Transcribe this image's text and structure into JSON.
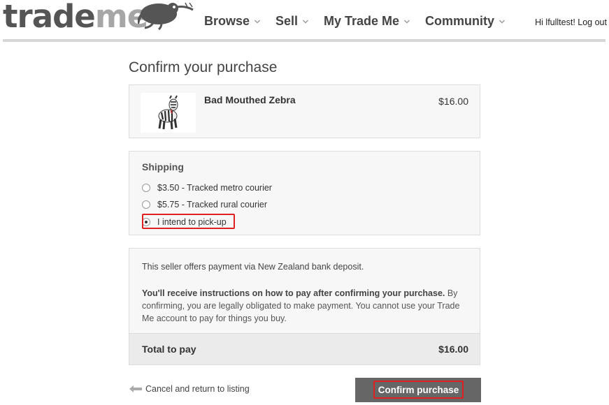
{
  "header": {
    "logo": {
      "part1": "trade",
      "part2": "me"
    },
    "nav": [
      {
        "label": "Browse"
      },
      {
        "label": "Sell"
      },
      {
        "label": "My Trade Me"
      },
      {
        "label": "Community"
      }
    ],
    "greeting": "Hi lfulltest!",
    "logout": "Log out"
  },
  "page": {
    "title": "Confirm your purchase"
  },
  "item": {
    "name": "Bad Mouthed Zebra",
    "price": "$16.00",
    "image_icon": "zebra-plush-image"
  },
  "shipping": {
    "title": "Shipping",
    "options": [
      {
        "label": "$3.50 - Tracked metro courier",
        "selected": false
      },
      {
        "label": "$5.75 - Tracked rural courier",
        "selected": false
      },
      {
        "label": "I intend to pick-up",
        "selected": true
      }
    ]
  },
  "payment": {
    "note": "This seller offers payment via New Zealand bank deposit.",
    "bold": "You'll receive instructions on how to pay after confirming your purchase.",
    "rest": " By confirming, you are legally obligated to make payment. You cannot use your Trade Me account to pay for things you buy.",
    "total_label": "Total to pay",
    "total_value": "$16.00"
  },
  "actions": {
    "cancel": "Cancel and return to listing",
    "confirm": "Confirm purchase"
  },
  "colors": {
    "highlight": "#e02020",
    "button": "#666666"
  }
}
